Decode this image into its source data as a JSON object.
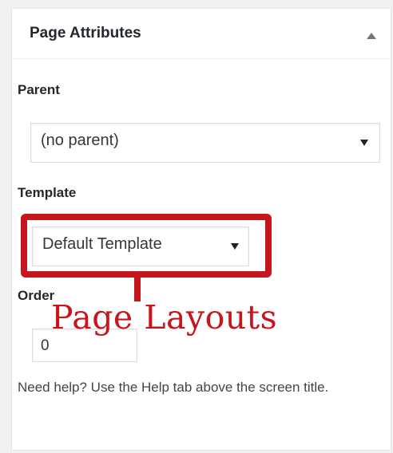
{
  "panel": {
    "title": "Page Attributes",
    "toggle_icon": "triangle-up-icon"
  },
  "parent": {
    "label": "Parent",
    "selected": "(no parent)",
    "caret_icon": "caret-down-icon"
  },
  "template": {
    "label": "Template",
    "selected": "Default Template",
    "caret_icon": "caret-down-icon"
  },
  "order": {
    "label": "Order",
    "value": "0"
  },
  "help_text": "Need help? Use the Help tab above the screen title.",
  "annotation": {
    "text": "Page  Layouts",
    "color": "#c4161c"
  }
}
